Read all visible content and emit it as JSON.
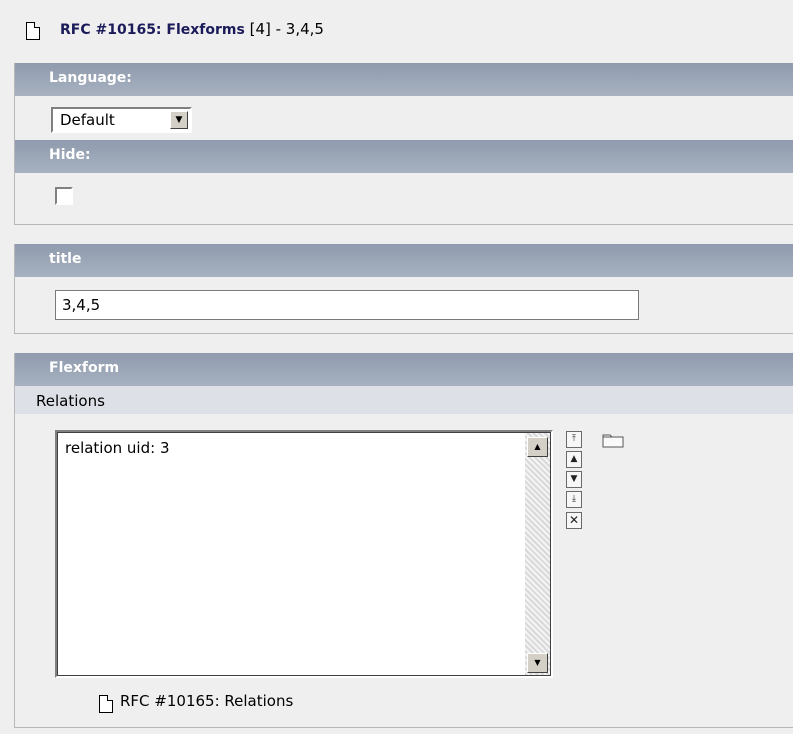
{
  "header": {
    "title": "RFC #10165: Flexforms",
    "count": "[4] - 3,4,5"
  },
  "language": {
    "label": "Language:",
    "selected": "Default"
  },
  "hide": {
    "label": "Hide:",
    "checked": false
  },
  "title_field": {
    "label": "title",
    "value": "3,4,5"
  },
  "flexform": {
    "label": "Flexform",
    "section": "Relations",
    "items": [
      "relation uid: 3"
    ],
    "record_link": "RFC #10165: Relations"
  },
  "icons": {
    "header": "page-icon",
    "controls": [
      "move-top-icon",
      "move-up-icon",
      "move-down-icon",
      "move-bottom-icon",
      "remove-icon",
      "folder-icon"
    ]
  },
  "colors": {
    "section_bar": "#9ca6b6",
    "title_text": "#1b1b5a",
    "background": "#f0efef"
  }
}
